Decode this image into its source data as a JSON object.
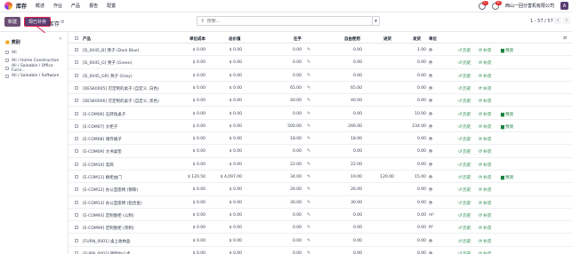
{
  "app": {
    "name": "库存",
    "company": "西山一回分害机有限公司",
    "avatar": "A"
  },
  "menu": [
    "概述",
    "作业",
    "产品",
    "报告",
    "配置"
  ],
  "badges": {
    "chat": "21",
    "activity": "30"
  },
  "control": {
    "new_label": "新建",
    "replenish_label": "现已补存",
    "title": "库存",
    "search_placeholder": "搜索...",
    "pager": "1 - 57 / 57"
  },
  "side": {
    "header": "类别",
    "items": [
      "All",
      "All / Home Construction",
      "All / Saleable / Office Furni...",
      "All / Saleable / Software"
    ]
  },
  "columns": {
    "product": "产品",
    "unit_cost": "单位成本",
    "total_value": "总价值",
    "on_hand": "在手",
    "free": "自由使用",
    "incoming": "进货",
    "outgoing": "发货",
    "uom": "单位"
  },
  "actions": {
    "history": "历史",
    "replenish": "补货",
    "forecast": "预测"
  },
  "rows": [
    {
      "product": "[D_0045_B] 凳子 (Dark Blue)",
      "unit_cost": "$ 0.00",
      "total_value": "$ 0.00",
      "on_hand": "0.00",
      "free": "0.00",
      "incoming": "",
      "outgoing": "1.00",
      "uom": "件",
      "forecast": true
    },
    {
      "product": "[D_0045_G] 凳子 (Green)",
      "unit_cost": "$ 0.00",
      "total_value": "$ 0.00",
      "on_hand": "0.00",
      "free": "0.00",
      "incoming": "",
      "outgoing": "0.00",
      "uom": "件",
      "forecast": false
    },
    {
      "product": "[D_0045_GR] 凳子 (Grey)",
      "unit_cost": "$ 0.00",
      "total_value": "$ 0.00",
      "on_hand": "0.00",
      "free": "0.00",
      "incoming": "",
      "outgoing": "0.00",
      "uom": "件",
      "forecast": false
    },
    {
      "product": "[DESK0005] 可定制的桌子 (自定义, 白色)",
      "unit_cost": "$ 0.00",
      "total_value": "$ 0.00",
      "on_hand": "65.00",
      "free": "65.00",
      "incoming": "",
      "outgoing": "0.00",
      "uom": "件",
      "forecast": false
    },
    {
      "product": "[DESK0006] 可定制的桌子 (自定义, 黑色)",
      "unit_cost": "$ 0.00",
      "total_value": "$ 0.00",
      "on_hand": "40.00",
      "free": "40.00",
      "incoming": "",
      "outgoing": "0.00",
      "uom": "件",
      "forecast": false
    },
    {
      "product": "[E-COM06] 石转角桌子",
      "unit_cost": "$ 0.00",
      "total_value": "$ 0.00",
      "on_hand": "0.00",
      "free": "0.00",
      "incoming": "",
      "outgoing": "10.00",
      "uom": "件",
      "forecast": true
    },
    {
      "product": "[E-COM07] 大柜子",
      "unit_cost": "$ 0.00",
      "total_value": "$ 0.00",
      "on_hand": "500.00",
      "free": "266.00",
      "incoming": "",
      "outgoing": "234.00",
      "uom": "件",
      "forecast": true
    },
    {
      "product": "[E-COM08] 储存箱子",
      "unit_cost": "$ 0.00",
      "total_value": "$ 0.00",
      "on_hand": "18.00",
      "free": "18.00",
      "incoming": "",
      "outgoing": "0.00",
      "uom": "件",
      "forecast": false
    },
    {
      "product": "[E-COM09] 大书桌垫",
      "unit_cost": "$ 0.00",
      "total_value": "$ 0.00",
      "on_hand": "0.00",
      "free": "0.00",
      "incoming": "",
      "outgoing": "0.00",
      "uom": "件",
      "forecast": false
    },
    {
      "product": "[E-COM10] 笔筒",
      "unit_cost": "$ 0.00",
      "total_value": "$ 0.00",
      "on_hand": "22.00",
      "free": "22.00",
      "incoming": "",
      "outgoing": "0.00",
      "uom": "件",
      "forecast": false
    },
    {
      "product": "[E-COM11] 橱柜由门",
      "unit_cost": "$ 120.50",
      "total_value": "$ 4,097.00",
      "on_hand": "34.00",
      "free": "19.00",
      "incoming": "120.00",
      "outgoing": "15.00",
      "uom": "件",
      "forecast": true
    },
    {
      "product": "[E-COM12] 办公室座椅 (钢铁)",
      "unit_cost": "$ 0.00",
      "total_value": "$ 0.00",
      "on_hand": "26.00",
      "free": "26.00",
      "incoming": "",
      "outgoing": "0.00",
      "uom": "件",
      "forecast": false
    },
    {
      "product": "[E-COM13] 办公室座椅 (铝合金)",
      "unit_cost": "$ 0.00",
      "total_value": "$ 0.00",
      "on_hand": "30.00",
      "free": "30.00",
      "incoming": "",
      "outgoing": "0.00",
      "uom": "件",
      "forecast": false
    },
    {
      "product": "[E-COM93] 定制图柜 (公制)",
      "unit_cost": "$ 0.00",
      "total_value": "$ 0.00",
      "on_hand": "0.00",
      "free": "0.00",
      "incoming": "",
      "outgoing": "0.00",
      "uom": "m²",
      "forecast": false
    },
    {
      "product": "[E-COM99] 定制图柜 (英制)",
      "unit_cost": "$ 0.00",
      "total_value": "$ 0.00",
      "on_hand": "0.00",
      "free": "0.00",
      "incoming": "",
      "outgoing": "0.00",
      "uom": "ft²",
      "forecast": false
    },
    {
      "product": "[FURN_0001] 桌上收纳盒",
      "unit_cost": "$ 0.00",
      "total_value": "$ 0.00",
      "on_hand": "0.00",
      "free": "0.00",
      "incoming": "",
      "outgoing": "0.00",
      "uom": "件",
      "forecast": false
    },
    {
      "product": "[FURN_0002] 钢架办公桌",
      "unit_cost": "$ 0.00",
      "total_value": "$ 0.00",
      "on_hand": "0.00",
      "free": "0.00",
      "incoming": "",
      "outgoing": "0.00",
      "uom": "件",
      "forecast": false
    }
  ],
  "colors": {
    "brand": "#5b3e72",
    "primary_button": "#6b4f74",
    "annotation": "#e11d48",
    "action": "#15803d"
  }
}
